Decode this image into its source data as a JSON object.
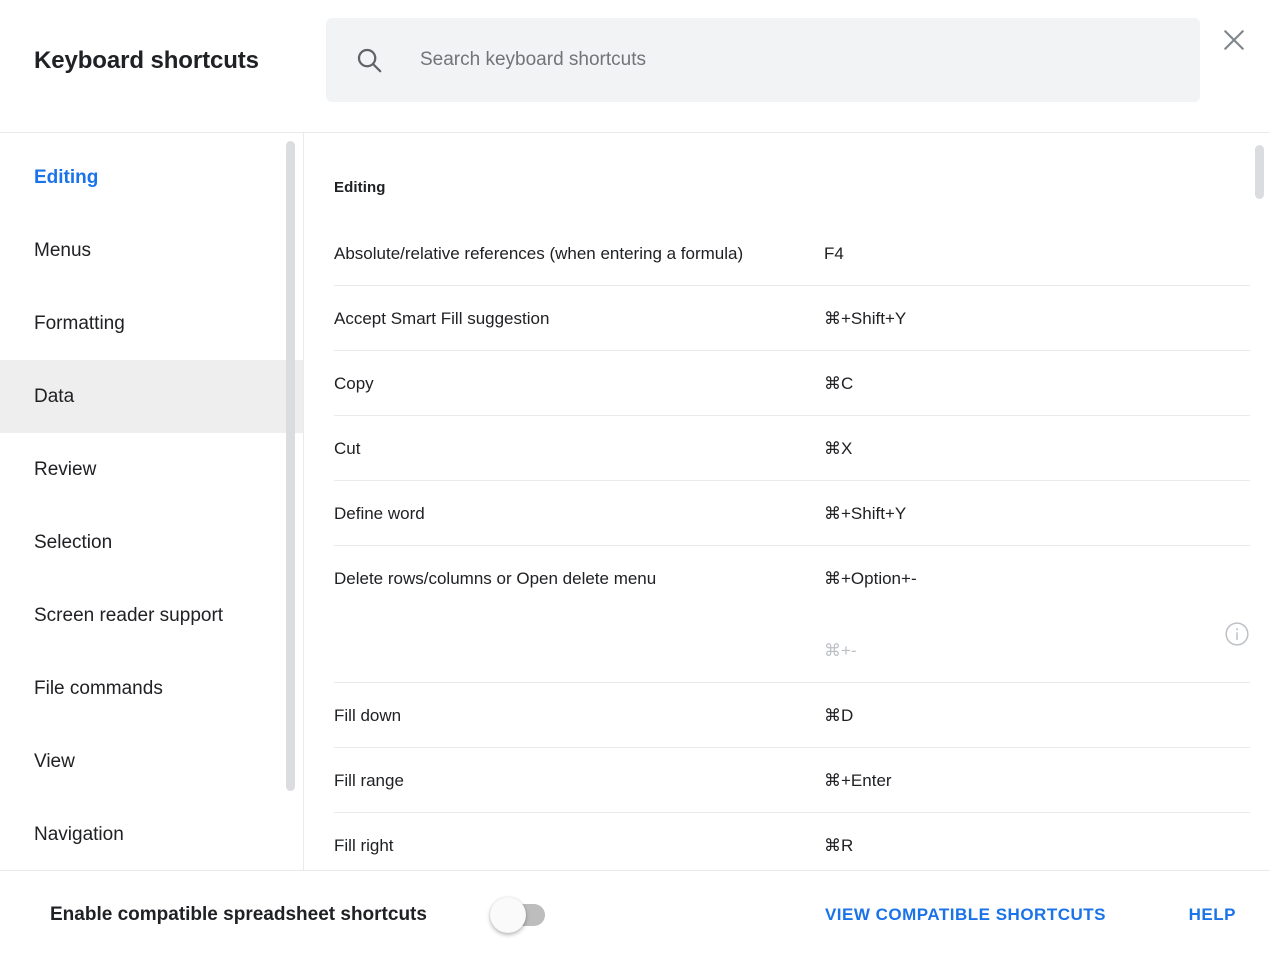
{
  "header": {
    "title": "Keyboard shortcuts",
    "search_placeholder": "Search keyboard shortcuts",
    "search_value": "",
    "search_icon": "search-icon",
    "close_icon": "close-icon"
  },
  "sidebar": {
    "items": [
      {
        "label": "Editing",
        "state": "active-link"
      },
      {
        "label": "Menus",
        "state": "normal"
      },
      {
        "label": "Formatting",
        "state": "normal"
      },
      {
        "label": "Data",
        "state": "selected"
      },
      {
        "label": "Review",
        "state": "normal"
      },
      {
        "label": "Selection",
        "state": "normal"
      },
      {
        "label": "Screen reader support",
        "state": "normal"
      },
      {
        "label": "File commands",
        "state": "normal"
      },
      {
        "label": "View",
        "state": "normal"
      },
      {
        "label": "Navigation",
        "state": "normal"
      }
    ]
  },
  "content": {
    "section_title": "Editing",
    "rows": [
      {
        "desc": "Absolute/relative references (when entering a formula)",
        "keys": "F4",
        "secondary": "",
        "info": false
      },
      {
        "desc": "Accept Smart Fill suggestion",
        "keys": "⌘+Shift+Y",
        "secondary": "",
        "info": false
      },
      {
        "desc": "Copy",
        "keys": "⌘C",
        "secondary": "",
        "info": false
      },
      {
        "desc": "Cut",
        "keys": "⌘X",
        "secondary": "",
        "info": false
      },
      {
        "desc": "Define word",
        "keys": "⌘+Shift+Y",
        "secondary": "",
        "info": false
      },
      {
        "desc": "Delete rows/columns or Open delete menu",
        "keys": "⌘+Option+-",
        "secondary": "⌘+-",
        "info": true,
        "info_icon": "info-icon"
      },
      {
        "desc": "Fill down",
        "keys": "⌘D",
        "secondary": "",
        "info": false
      },
      {
        "desc": "Fill range",
        "keys": "⌘+Enter",
        "secondary": "",
        "info": false
      },
      {
        "desc": "Fill right",
        "keys": "⌘R",
        "secondary": "",
        "info": false
      }
    ]
  },
  "footer": {
    "toggle_label": "Enable compatible spreadsheet shortcuts",
    "toggle_on": false,
    "view_compatible_label": "VIEW COMPATIBLE SHORTCUTS",
    "help_label": "HELP"
  },
  "colors": {
    "accent": "#1a73e8",
    "text": "#202124",
    "muted": "#bdc1c6",
    "divider": "#e8eaed",
    "search_bg": "#f1f3f4",
    "selected_bg": "#eeeeee",
    "scrollbar": "#dadce0"
  }
}
